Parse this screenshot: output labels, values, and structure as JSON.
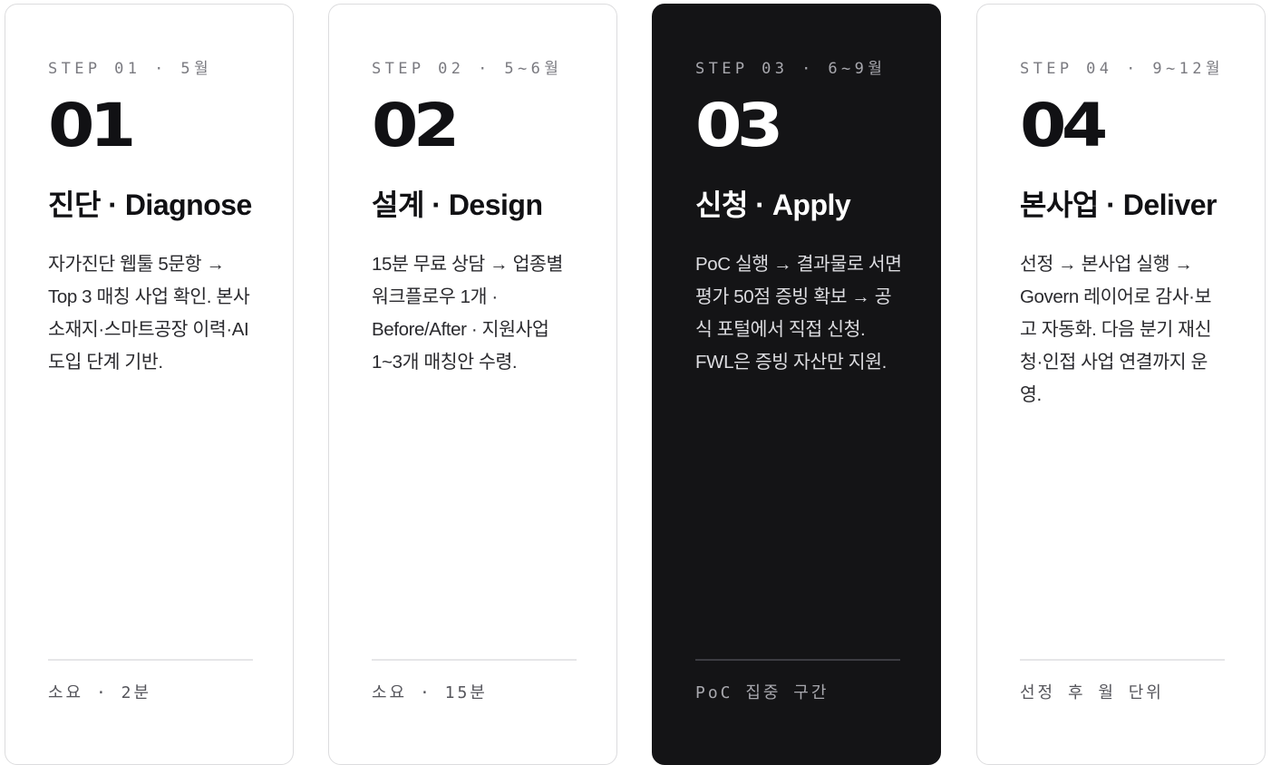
{
  "cards": [
    {
      "step": "STEP 01 · 5월",
      "number": "01",
      "title": "진단 · Diagnose",
      "description": "자가진단 웹툴 5문항 → Top 3 매칭 사업 확인. 본사 소재지·스마트공장 이력·AI 도입 단계 기반.",
      "footer": "소요 · 2분"
    },
    {
      "step": "STEP 02 · 5~6월",
      "number": "02",
      "title": "설계 · Design",
      "description": "15분 무료 상담 → 업종별 워크플로우 1개 · Before/After · 지원사업 1~3개 매칭안 수령.",
      "footer": "소요 · 15분"
    },
    {
      "step": "STEP 03 · 6~9월",
      "number": "03",
      "title": "신청 · Apply",
      "description": "PoC 실행 → 결과물로 서면평가 50점 증빙 확보 → 공식 포털에서 직접 신청. FWL은 증빙 자산만 지원.",
      "footer": "PoC 집중 구간"
    },
    {
      "step": "STEP 04 · 9~12월",
      "number": "04",
      "title": "본사업 · Deliver",
      "description": "선정 → 본사업 실행 → Govern 레이어로 감사·보고 자동화. 다음 분기 재신청·인접 사업 연결까지 운영.",
      "footer": "선정 후 월 단위"
    }
  ]
}
